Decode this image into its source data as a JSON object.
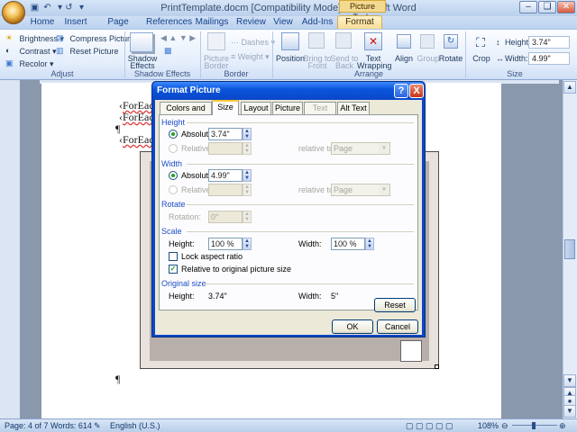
{
  "window": {
    "title": "PrintTemplate.docm [Compatibility Mode] - Microsoft Word",
    "contextual_tab": "Picture Tools",
    "minimize": "–",
    "restore": "❏",
    "close": "✕"
  },
  "tabs": [
    "Home",
    "Insert",
    "Page Layout",
    "References",
    "Mailings",
    "Review",
    "View",
    "Add-Ins",
    "Format"
  ],
  "ribbon": {
    "adjust": {
      "brightness": "Brightness",
      "contrast": "Contrast",
      "recolor": "Recolor",
      "compress": "Compress Pictures",
      "reset": "Reset Picture",
      "label": "Adjust"
    },
    "shadow": {
      "shadow_effects_1": "Shadow",
      "shadow_effects_2": "Effects",
      "label": "Shadow Effects"
    },
    "border": {
      "picture_border_1": "Picture",
      "picture_border_2": "Border",
      "dashes": "Dashes",
      "weight": "Weight",
      "label": "Border"
    },
    "arrange": {
      "position": "Position",
      "bring_front_1": "Bring to",
      "bring_front_2": "Front",
      "send_back_1": "Send to",
      "send_back_2": "Back",
      "text_wrapping_1": "Text",
      "text_wrapping_2": "Wrapping",
      "align": "Align",
      "group": "Group",
      "rotate": "Rotate",
      "label": "Arrange"
    },
    "size": {
      "crop": "Crop",
      "height_label": "Height:",
      "height_value": "3.74\"",
      "width_label": "Width:",
      "width_value": "4.99\"",
      "label": "Size"
    }
  },
  "document": {
    "lines": [
      "ForEac",
      "ForEac",
      "¶",
      "ForEac"
    ],
    "pilcrow_bottom": "¶"
  },
  "dialog": {
    "title": "Format Picture",
    "help": "?",
    "close": "X",
    "tabs": [
      "Colors and Lines",
      "Size",
      "Layout",
      "Picture",
      "Text Box",
      "Alt Text"
    ],
    "height_section": "Height",
    "absolute_label": "Absolute",
    "height_abs_value": "3.74\"",
    "relative_label": "Relative",
    "relative_to_label": "relative to",
    "relative_to_value": "Page",
    "width_section": "Width",
    "width_abs_value": "4.99\"",
    "rotate_section": "Rotate",
    "rotation_label": "Rotation:",
    "rotation_value": "0°",
    "scale_section": "Scale",
    "scale_height_label": "Height:",
    "scale_height_value": "100 %",
    "scale_width_label": "Width:",
    "scale_width_value": "100 %",
    "lock_aspect_label": "Lock aspect ratio",
    "relative_original_label": "Relative to original picture size",
    "original_size_section": "Original size",
    "orig_height_label": "Height:",
    "orig_height_value": "3.74\"",
    "orig_width_label": "Width:",
    "orig_width_value": "5\"",
    "reset_label": "Reset",
    "ok_label": "OK",
    "cancel_label": "Cancel"
  },
  "statusbar": {
    "page": "Page: 4 of 7",
    "words": "Words: 614",
    "language": "English (U.S.)",
    "zoom": "108%"
  },
  "colors": {
    "dialog_title_blue": "#0b55dc",
    "ribbon_blue": "#dce8f8",
    "accent_orange": "#ffc83c"
  }
}
